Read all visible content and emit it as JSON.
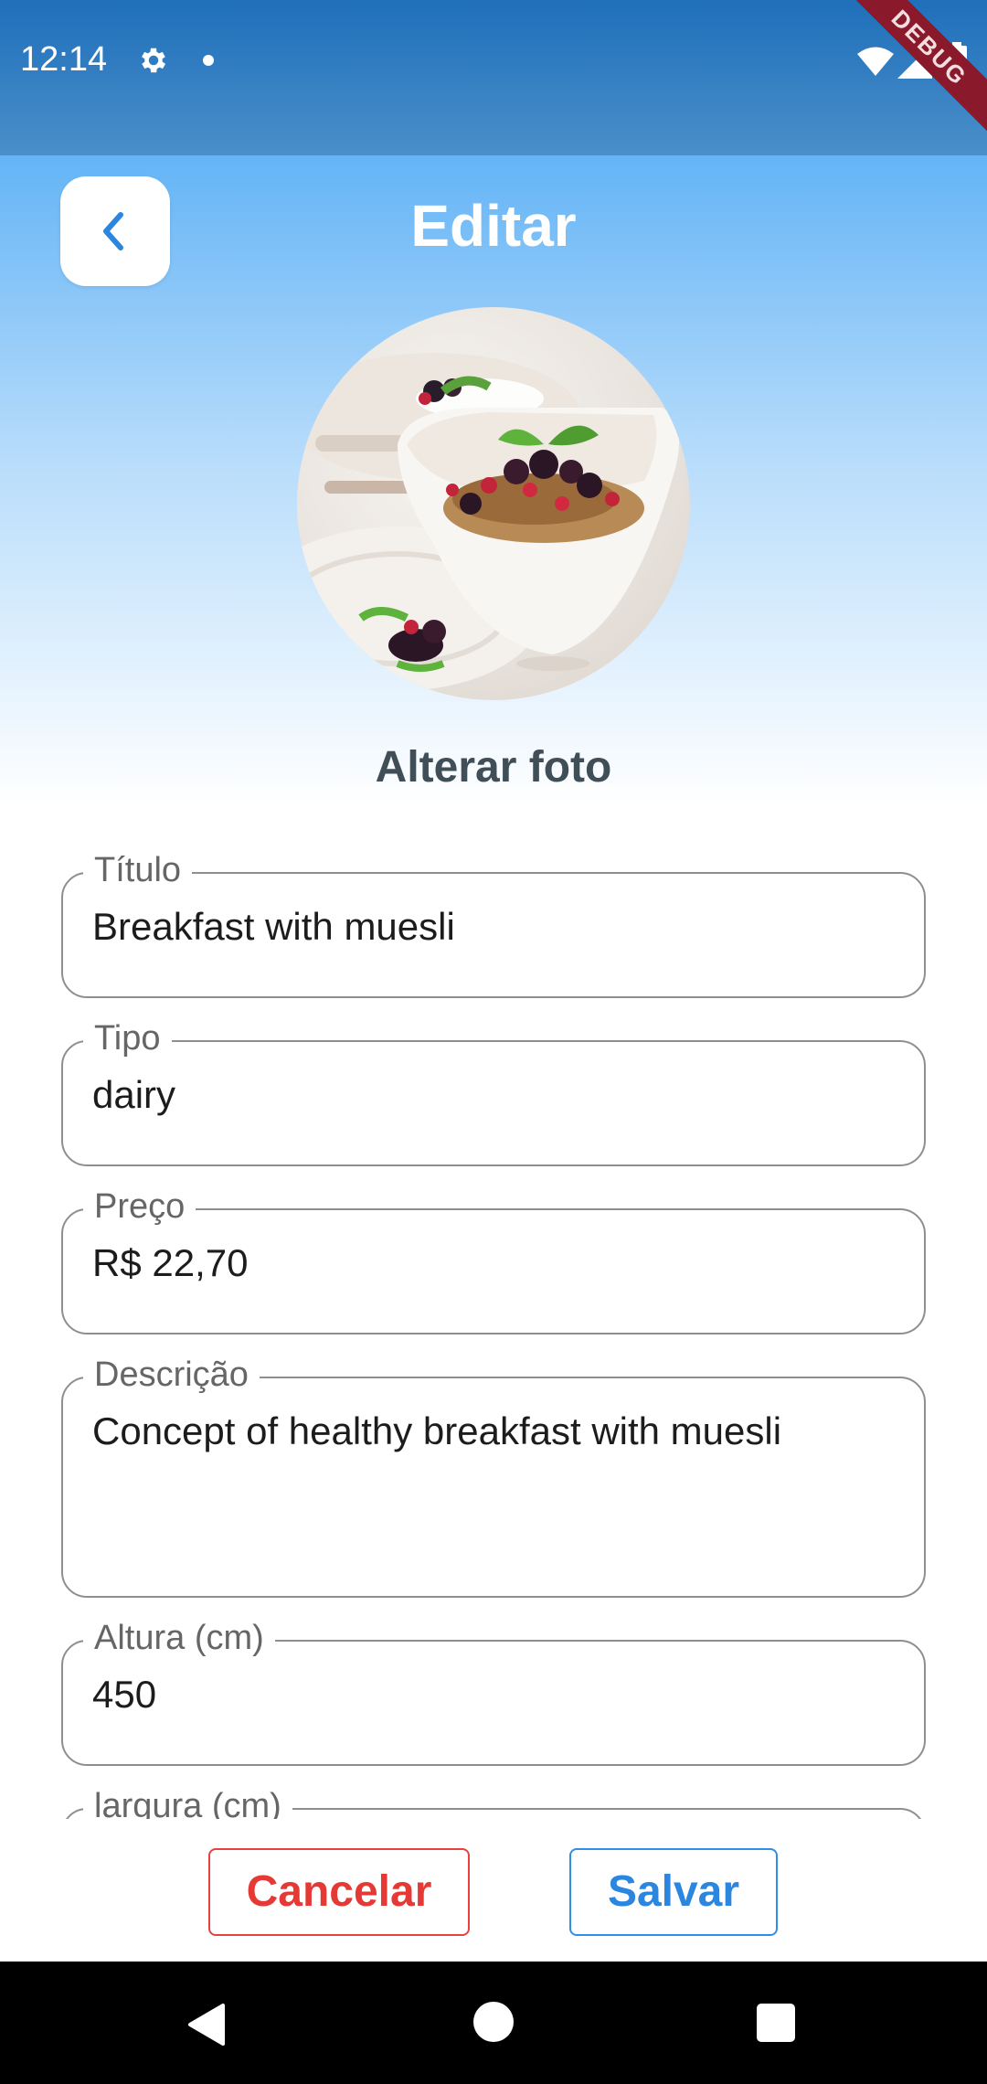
{
  "status_bar": {
    "time": "12:14",
    "icons": [
      "gear-icon",
      "notification-dot-icon",
      "wifi-icon",
      "signal-icon",
      "battery-icon"
    ],
    "debug_banner": "DEBUG"
  },
  "header": {
    "back_icon": "chevron-left-icon",
    "title": "Editar"
  },
  "photo": {
    "description_icon": "breakfast-muesli-photo",
    "change_label": "Alterar foto"
  },
  "form": {
    "fields": [
      {
        "label": "Título",
        "value": "Breakfast with muesli"
      },
      {
        "label": "Tipo",
        "value": "dairy"
      },
      {
        "label": "Preço",
        "value": "R$ 22,70"
      },
      {
        "label": "Descrição",
        "value": "Concept of healthy breakfast with muesli"
      },
      {
        "label": "Altura (cm)",
        "value": "450"
      },
      {
        "label": "largura (cm)",
        "value": ""
      }
    ]
  },
  "actions": {
    "cancel_label": "Cancelar",
    "save_label": "Salvar"
  },
  "colors": {
    "accent": "#2a86df",
    "danger": "#e53935",
    "header_gradient_top": "#64b4f6",
    "status_bar": "#1f6fba"
  },
  "nav_bar": {
    "icons": [
      "nav-back-icon",
      "nav-home-icon",
      "nav-recents-icon"
    ]
  }
}
